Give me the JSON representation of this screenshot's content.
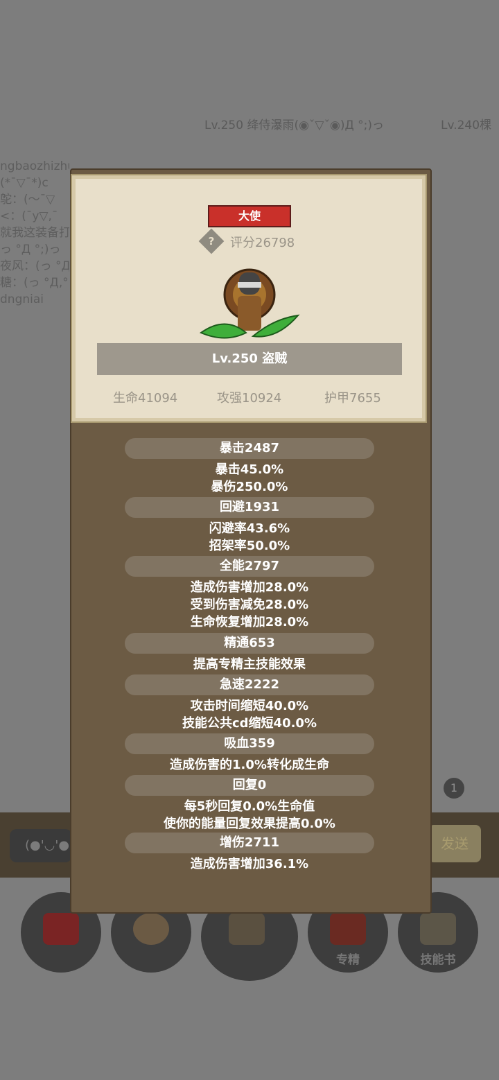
{
  "background": {
    "rank_entries": [
      "Lv.250 绛侍瀑雨(◉ˇ▽ˇ◉)Д °;)っ",
      "Lv.240棵"
    ],
    "chat_lines": [
      "ngbaozhizhu",
      "(*¯▽¯*)c",
      "鸵：(～¯▽",
      "<：(¯y▽,¯",
      "就我这装备打",
      "っ °Д °;)っ",
      "夜风：(っ °Д",
      "糖：(っ °Д,°",
      "dngniai"
    ],
    "input_emoji": "(●'◡'●",
    "send_label": "发送",
    "unread_badge": "1",
    "bottom_buttons": [
      {
        "name": "potion",
        "label": ""
      },
      {
        "name": "bread",
        "label": ""
      },
      {
        "name": "chest",
        "label": ""
      },
      {
        "name": "specialization",
        "label": "专精"
      },
      {
        "name": "skill-book",
        "label": "技能书"
      }
    ]
  },
  "profile": {
    "title_tag": "大使",
    "score_icon": "?",
    "score": "评分26798",
    "name": "Lv.250 盗贼",
    "base_stats": [
      "生命41094",
      "攻强10924",
      "护甲7655"
    ]
  },
  "stats": [
    {
      "header": "暴击2487",
      "lines": [
        "暴击45.0%",
        "暴伤250.0%"
      ]
    },
    {
      "header": "回避1931",
      "lines": [
        "闪避率43.6%",
        "招架率50.0%"
      ]
    },
    {
      "header": "全能2797",
      "lines": [
        "造成伤害增加28.0%",
        "受到伤害减免28.0%",
        "生命恢复增加28.0%"
      ]
    },
    {
      "header": "精通653",
      "lines": [
        "提高专精主技能效果"
      ]
    },
    {
      "header": "急速2222",
      "lines": [
        "攻击时间缩短40.0%",
        "技能公共cd缩短40.0%"
      ]
    },
    {
      "header": "吸血359",
      "lines": [
        "造成伤害的1.0%转化成生命"
      ]
    },
    {
      "header": "回复0",
      "lines": [
        "每5秒回复0.0%生命值",
        "使你的能量回复效果提高0.0%"
      ]
    },
    {
      "header": "增伤2711",
      "lines": [
        "造成伤害增加36.1%"
      ]
    }
  ],
  "colors": {
    "class_tag": "#c9302a",
    "parchment": "#e8dfca",
    "panel": "#6c5b44"
  }
}
